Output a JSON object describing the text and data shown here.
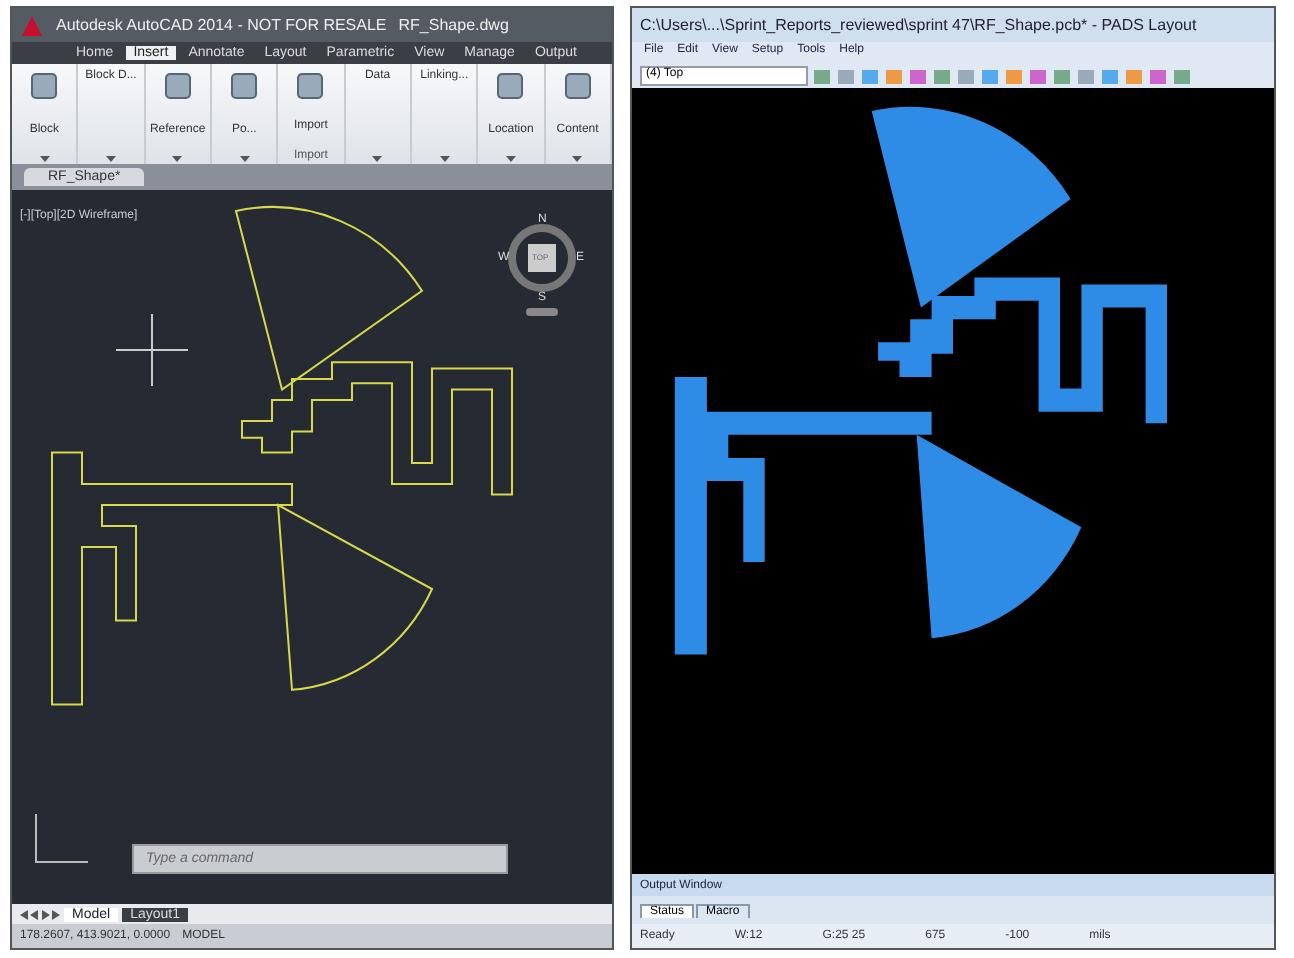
{
  "cad": {
    "title": "Autodesk AutoCAD 2014 - NOT FOR RESALE",
    "file": "RF_Shape.dwg",
    "ribbon_tabs": [
      {
        "label": "Home",
        "selected": false
      },
      {
        "label": "Insert",
        "selected": true
      },
      {
        "label": "Annotate",
        "selected": false
      },
      {
        "label": "Layout",
        "selected": false
      },
      {
        "label": "Parametric",
        "selected": false
      },
      {
        "label": "View",
        "selected": false
      },
      {
        "label": "Manage",
        "selected": false
      },
      {
        "label": "Output",
        "selected": false
      }
    ],
    "panels": [
      {
        "label": "Block",
        "kind": "big"
      },
      {
        "label": "Block D...",
        "kind": "small"
      },
      {
        "label": "Reference",
        "kind": "big"
      },
      {
        "label": "Po...",
        "kind": "big"
      },
      {
        "label": "Import",
        "kind": "big",
        "footer": "Import"
      },
      {
        "label": "Data",
        "kind": "small"
      },
      {
        "label": "Linking...",
        "kind": "small"
      },
      {
        "label": "Location",
        "kind": "big"
      },
      {
        "label": "Content",
        "kind": "big"
      }
    ],
    "doc_tab": "RF_Shape*",
    "viewport_label": "[-][Top][2D Wireframe]",
    "viewcube": {
      "north": "N",
      "west": "W",
      "east": "E",
      "south": "S",
      "face": "TOP"
    },
    "command": {
      "placeholder": "Type a command"
    },
    "layout_tabs": [
      {
        "label": "Model",
        "selected": true
      },
      {
        "label": "Layout1",
        "selected": false
      }
    ],
    "coordinates": "178.2607, 413.9021, 0.0000",
    "mode": "MODEL"
  },
  "pads": {
    "title": "C:\\Users\\...\\Sprint_Reports_reviewed\\sprint 47\\RF_Shape.pcb* - PADS Layout",
    "menu": [
      "File",
      "Edit",
      "View",
      "Setup",
      "Tools",
      "Help"
    ],
    "layer": "(4) Top",
    "output_title": "Output Window",
    "tabs": [
      {
        "label": "Status",
        "selected": true
      },
      {
        "label": "Macro",
        "selected": false
      }
    ],
    "status": [
      "Ready",
      "W:12",
      "G:25 25",
      "675",
      "-100",
      "mils"
    ]
  }
}
